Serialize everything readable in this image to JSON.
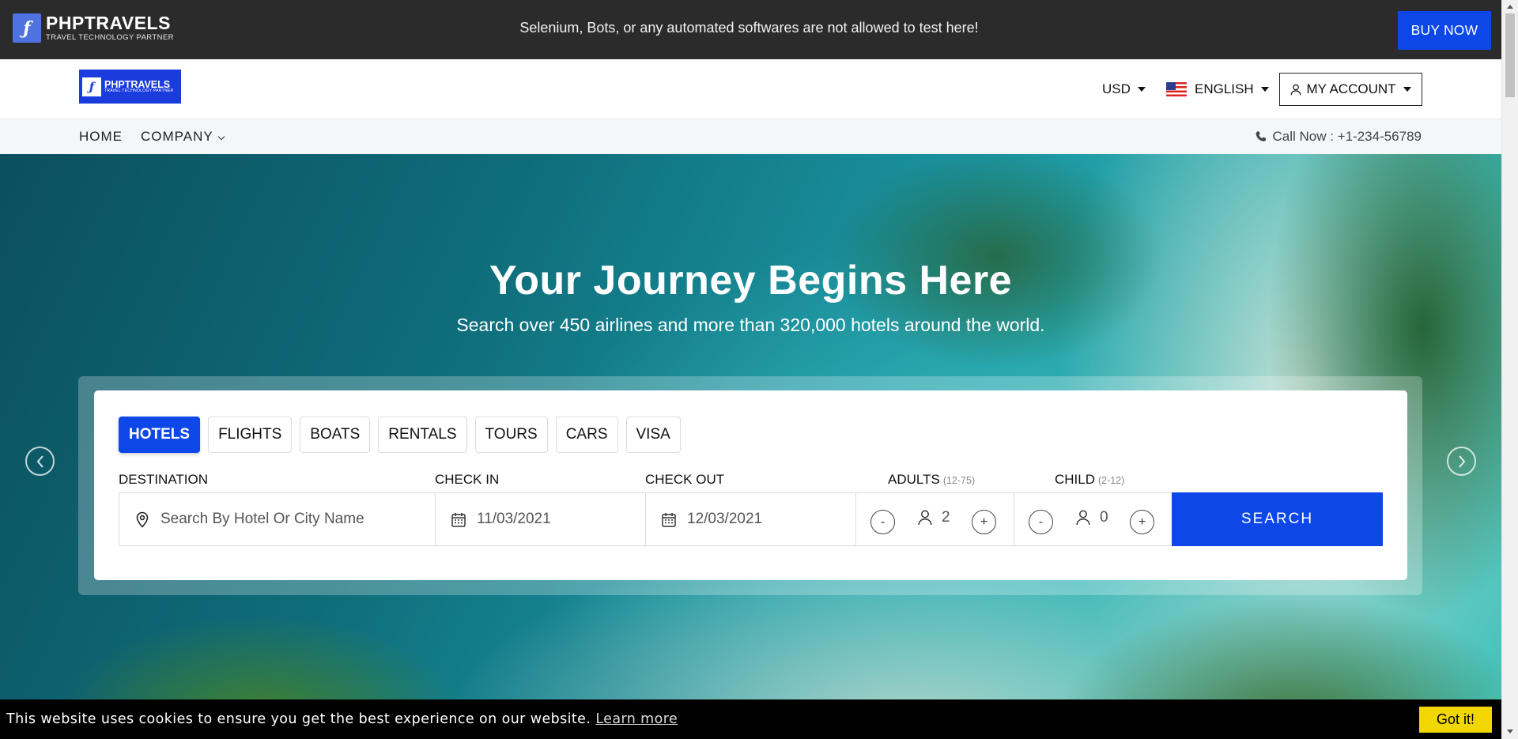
{
  "topbar": {
    "logo_name": "PHPTRAVELS",
    "logo_tagline": "TRAVEL TECHNOLOGY PARTNER",
    "notice": "Selenium, Bots, or any automated softwares are not allowed to test here!",
    "buy_now": "BUY NOW"
  },
  "header": {
    "logo_name": "PHPTRAVELS",
    "logo_tagline": "TRAVEL TECHNOLOGY PARTNER",
    "currency": "USD",
    "language": "ENGLISH",
    "account": "MY ACCOUNT"
  },
  "nav": {
    "home": "HOME",
    "company": "COMPANY",
    "call": "Call Now : +1-234-56789"
  },
  "hero": {
    "title": "Your Journey Begins Here",
    "subtitle": "Search over 450 airlines and more than 320,000 hotels around the world."
  },
  "search": {
    "tabs": [
      {
        "label": "HOTELS",
        "active": true
      },
      {
        "label": "FLIGHTS",
        "active": false
      },
      {
        "label": "BOATS",
        "active": false
      },
      {
        "label": "RENTALS",
        "active": false
      },
      {
        "label": "TOURS",
        "active": false
      },
      {
        "label": "CARS",
        "active": false
      },
      {
        "label": "VISA",
        "active": false
      }
    ],
    "labels": {
      "destination": "DESTINATION",
      "checkin": "CHECK IN",
      "checkout": "CHECK OUT",
      "adults": "ADULTS",
      "adults_range": "(12-75)",
      "child": "CHILD",
      "child_range": "(2-12)"
    },
    "destination_placeholder": "Search By Hotel Or City Name",
    "checkin_value": "11/03/2021",
    "checkout_value": "12/03/2021",
    "adults_count": "2",
    "child_count": "0",
    "minus": "-",
    "plus": "+",
    "button": "SEARCH"
  },
  "cookie": {
    "message": "This website uses cookies to ensure you get the best experience on our website.",
    "learn_more": "Learn more",
    "got_it": "Got it!"
  },
  "colors": {
    "brand_blue": "#0d47e8",
    "topbar_bg": "#2b2b2b",
    "cookie_button": "#f1d600"
  }
}
